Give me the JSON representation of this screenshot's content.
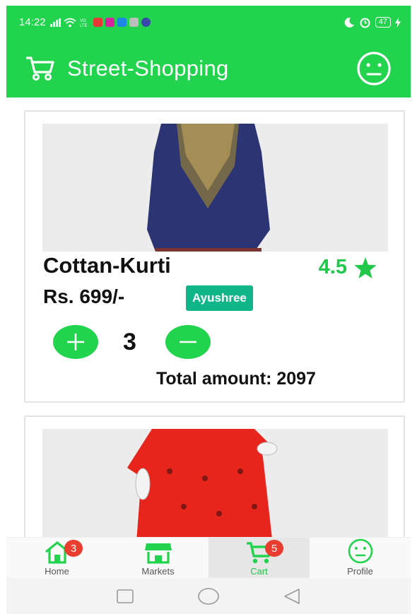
{
  "status_bar": {
    "time": "14:22",
    "battery": "47"
  },
  "app_bar": {
    "title": "Street-Shopping"
  },
  "products": [
    {
      "name": "Cottan-Kurti",
      "rating": "4.5",
      "price": "Rs. 699/-",
      "shop": "Ayushree",
      "quantity": "3",
      "total": "Total amount: 2097"
    }
  ],
  "bottom_nav": {
    "home": {
      "label": "Home",
      "badge": "3"
    },
    "markets": {
      "label": "Markets"
    },
    "cart": {
      "label": "Cart",
      "badge": "5"
    },
    "profile": {
      "label": "Profile"
    }
  },
  "colors": {
    "brand_green": "#22d34d",
    "badge_teal": "#10b58a",
    "badge_red": "#e93d2f"
  }
}
